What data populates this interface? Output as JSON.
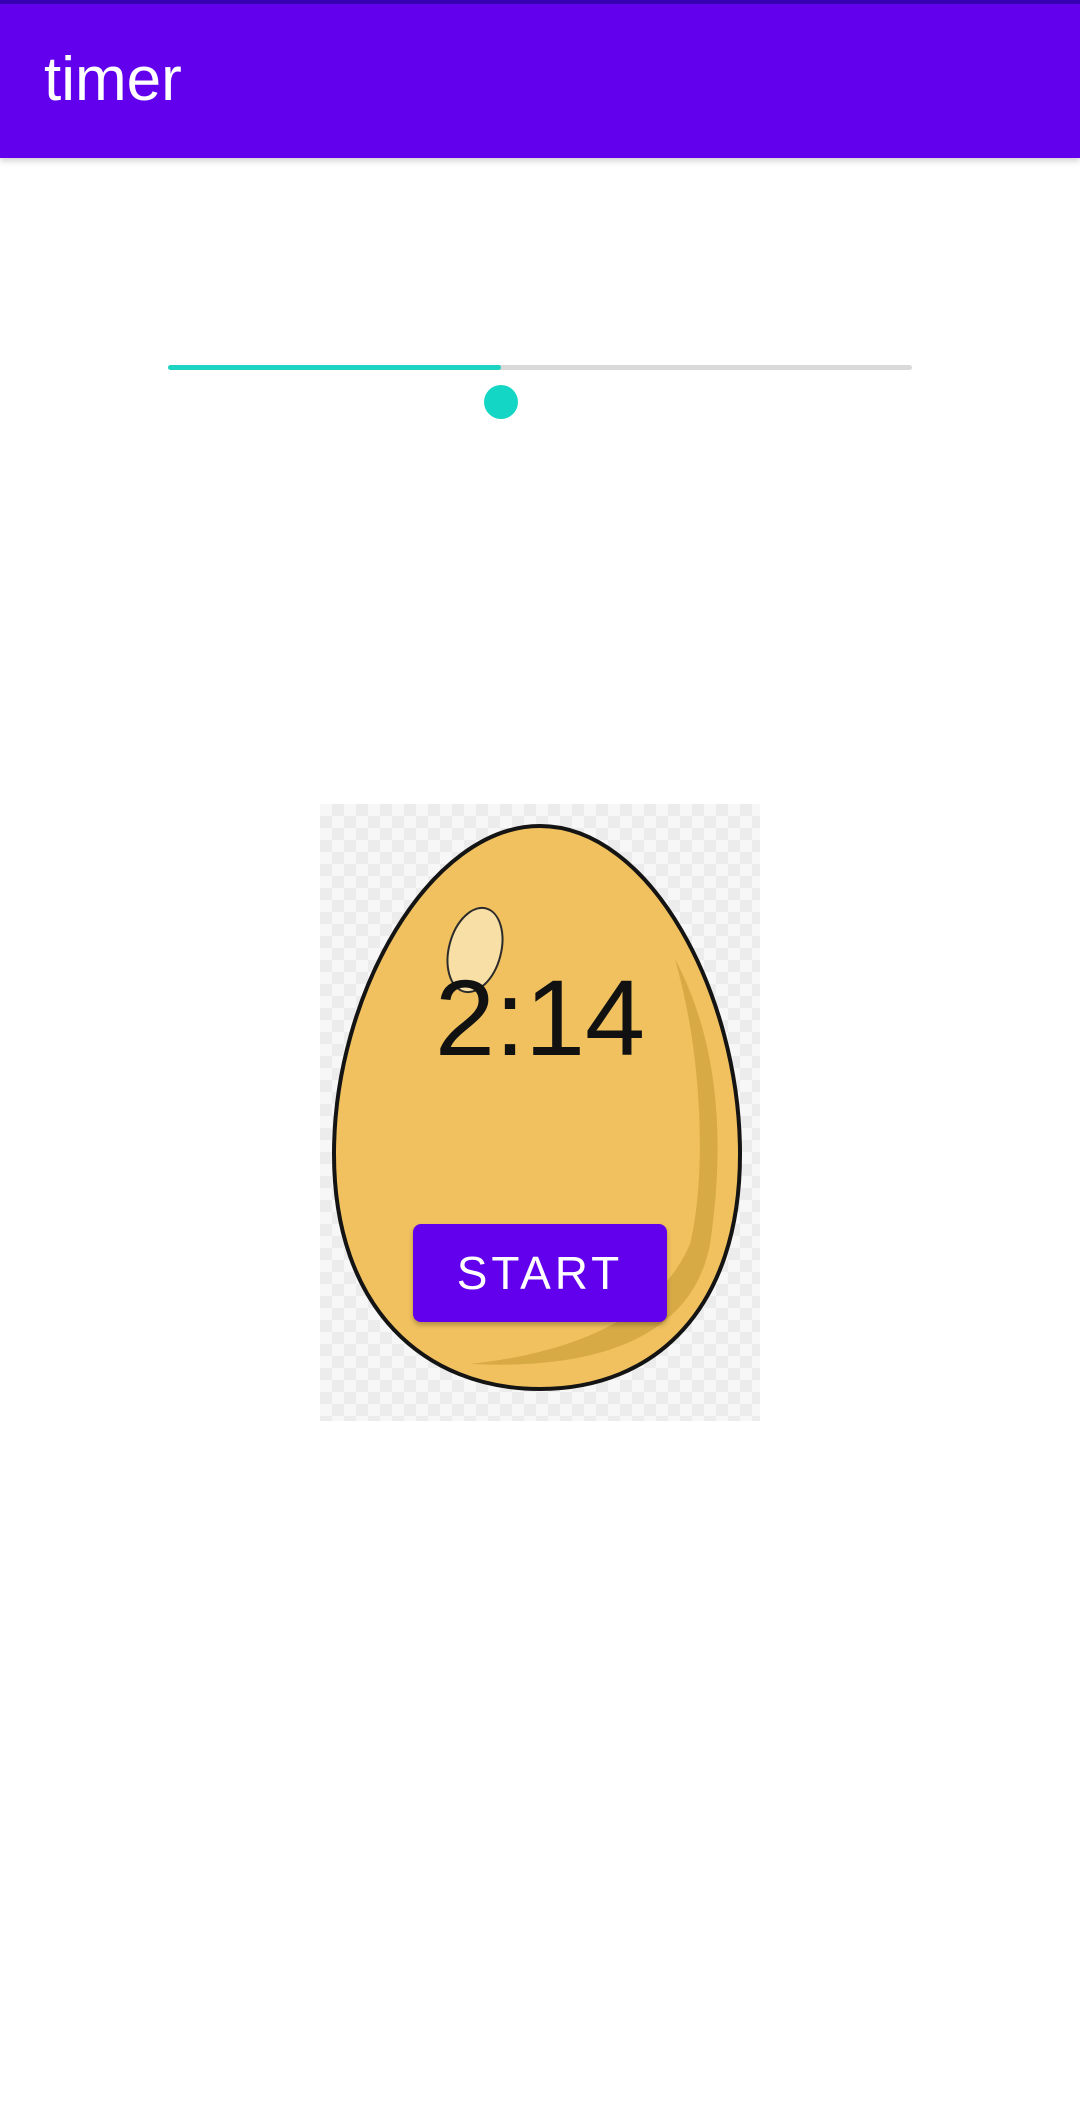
{
  "app_bar": {
    "title": "timer"
  },
  "seekbar": {
    "progress_fraction": 0.447,
    "active_color": "#1dd3c2",
    "inactive_color": "#d9d9d9"
  },
  "egg": {
    "image_icon": "egg-icon",
    "shell_color": "#f0c15e",
    "shade_color": "#d4a744",
    "highlight_color": "#f7dfa6"
  },
  "timer": {
    "display": "2:14"
  },
  "controls": {
    "start_label": "START"
  },
  "colors": {
    "primary": "#6200ee",
    "primary_dark": "#3700b3"
  }
}
